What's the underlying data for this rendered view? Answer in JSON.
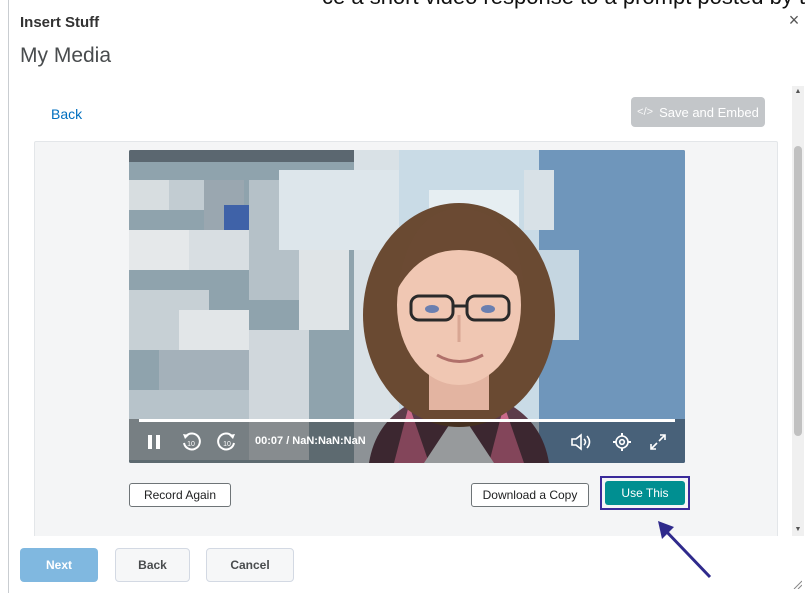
{
  "top_cut_text": "ce a short video response to a prompt posted by the course designer using a",
  "dialog": {
    "title": "Insert Stuff",
    "close_glyph": "×",
    "subtitle": "My Media"
  },
  "toolbar": {
    "back_label": "Back",
    "save_embed_icon": "</>",
    "save_embed_label": "Save and Embed"
  },
  "player": {
    "time_label": "00:07 / NaN:NaN:NaN",
    "progress_fraction": 1.0,
    "icons": [
      "pause-icon",
      "rewind-10-icon",
      "forward-10-icon",
      "volume-icon",
      "settings-gear-icon",
      "fullscreen-icon"
    ]
  },
  "actions": {
    "record_again_label": "Record Again",
    "download_copy_label": "Download a Copy",
    "use_this_label": "Use This"
  },
  "footer": {
    "next_label": "Next",
    "back_label": "Back",
    "cancel_label": "Cancel"
  },
  "colors": {
    "accent_teal": "#008f91",
    "link_blue": "#006fbf",
    "next_disabled": "#80b8e0",
    "highlight_border": "#3a2a9a",
    "save_disabled": "#c3c6c9"
  }
}
